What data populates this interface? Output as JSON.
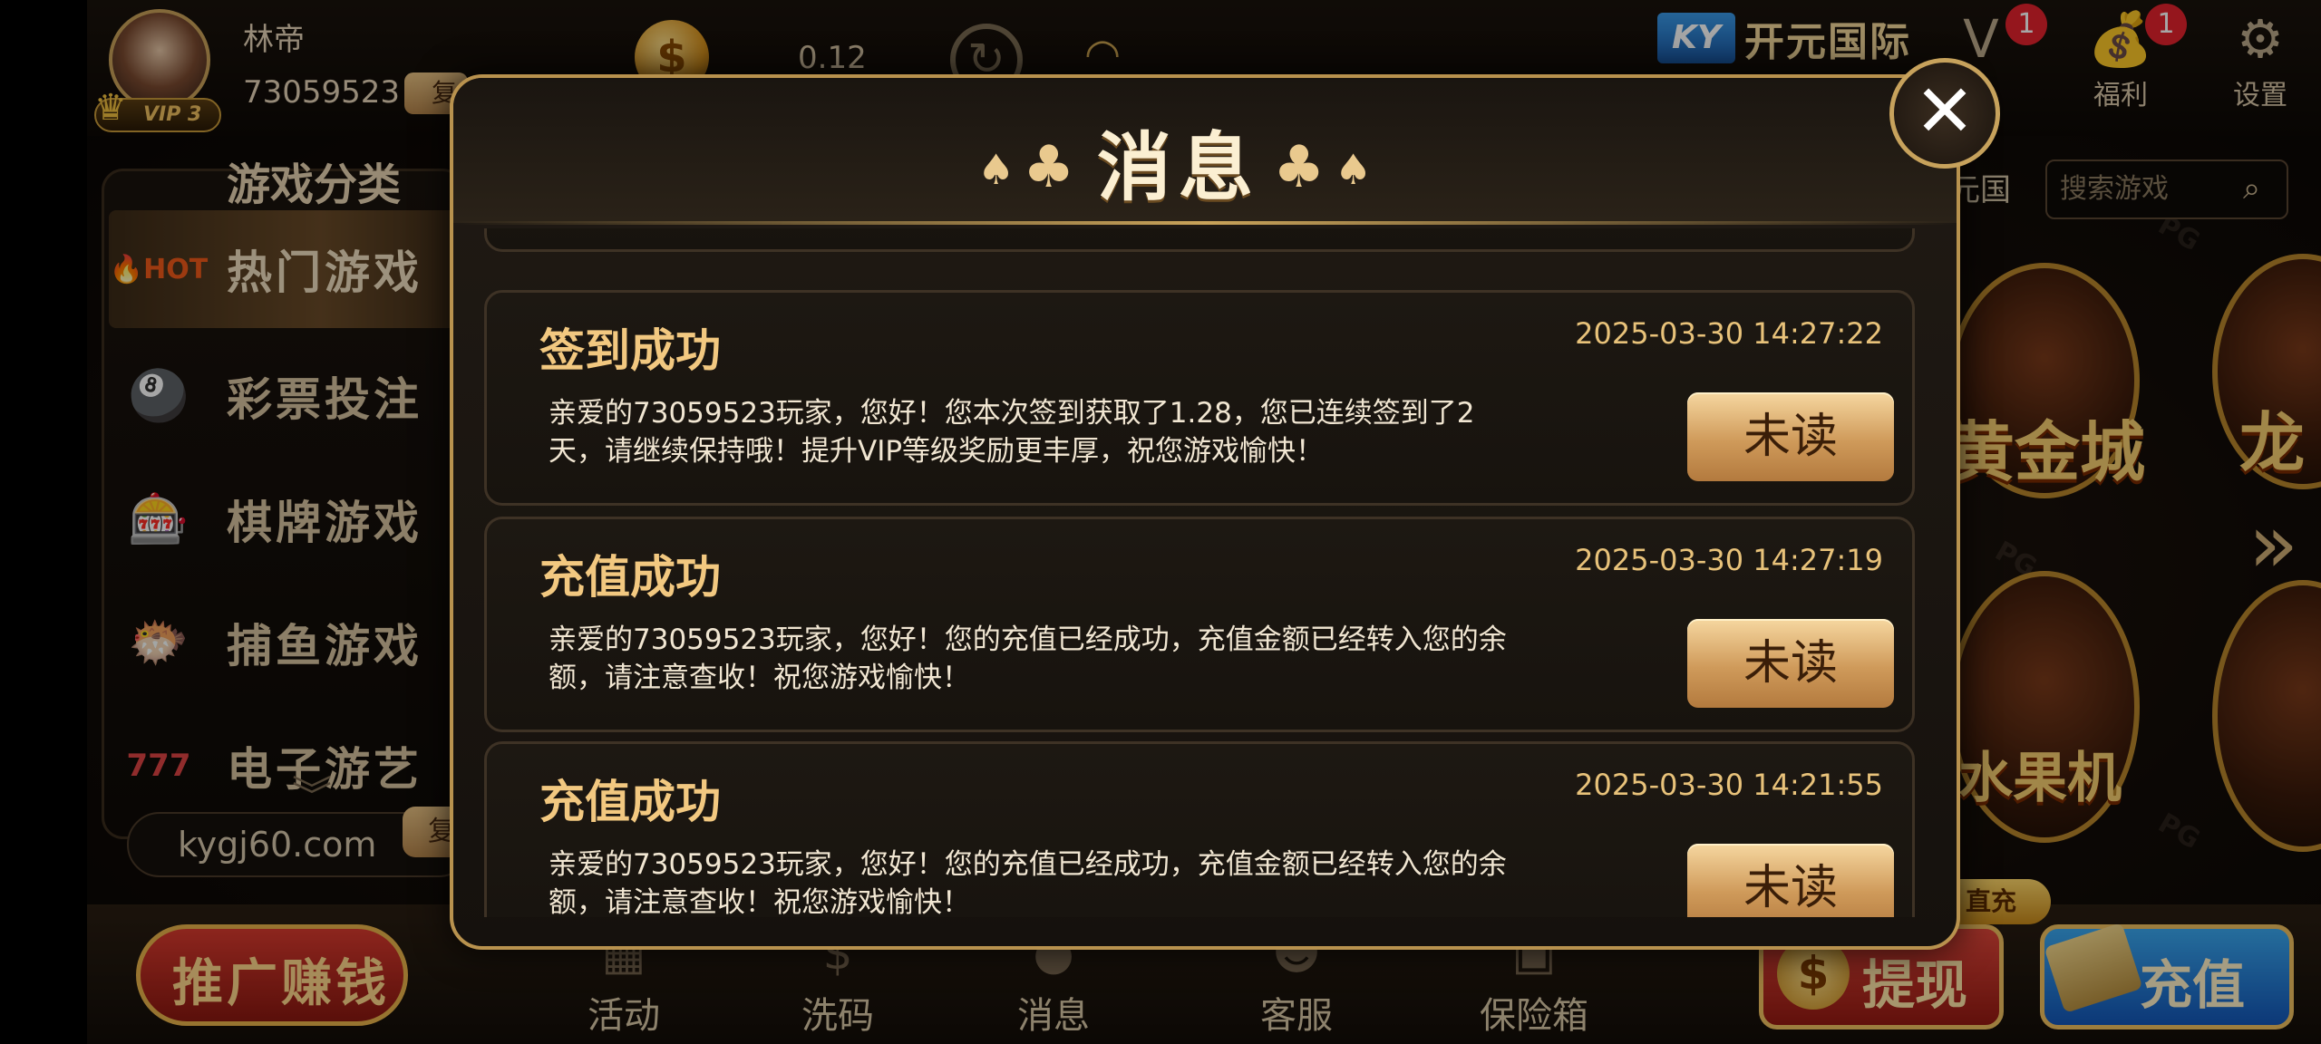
{
  "header": {
    "username": "林帝",
    "user_id": "73059523",
    "copy_label": "复",
    "vip_label": "VIP 3",
    "balance": "0.12",
    "brand_ky": "KY",
    "brand_name": "开元国际",
    "vip_badge_count": "1",
    "welfare_label": "福利",
    "welfare_badge_count": "1",
    "settings_label": "设置"
  },
  "sidebar": {
    "title": "游戏分类",
    "items": [
      {
        "label": "热门游戏",
        "icon": "hot-icon"
      },
      {
        "label": "彩票投注",
        "icon": "lottery-icon"
      },
      {
        "label": "棋牌游戏",
        "icon": "chips-icon"
      },
      {
        "label": "捕鱼游戏",
        "icon": "fish-icon"
      },
      {
        "label": "电子游艺",
        "icon": "slot-icon"
      }
    ],
    "site_url": "kygj60.com",
    "copy_label": "复"
  },
  "search": {
    "tab_label": "元国",
    "placeholder": "搜索游戏"
  },
  "tiles": [
    "黄金城",
    "龙",
    "水果机"
  ],
  "bottom_nav": {
    "promo_label": "推广赚钱",
    "items": [
      "活动",
      "洗码",
      "消息",
      "客服",
      "保险箱"
    ],
    "withdraw_label": "提现",
    "recharge_label": "充值",
    "direct_charge_label": "直充"
  },
  "modal": {
    "title": "消息",
    "messages": [
      {
        "title": "签到成功",
        "time": "2025-03-30 14:27:22",
        "body": "亲爱的73059523玩家，您好！您本次签到获取了1.28，您已连续签到了2天，请继续保持哦！提升VIP等级奖励更丰厚，祝您游戏愉快！",
        "status": "未读"
      },
      {
        "title": "充值成功",
        "time": "2025-03-30 14:27:19",
        "body": "亲爱的73059523玩家，您好！您的充值已经成功，充值金额已经转入您的余额，请注意查收！祝您游戏愉快！",
        "status": "未读"
      },
      {
        "title": "充值成功",
        "time": "2025-03-30 14:21:55",
        "body": "亲爱的73059523玩家，您好！您的充值已经成功，充值金额已经转入您的余额，请注意查收！祝您游戏愉快！",
        "status": "未读"
      }
    ]
  },
  "colors": {
    "gold_accent": "#c9a35a",
    "unread_button": "#cf9a5a",
    "badge_red": "#e5232d"
  }
}
